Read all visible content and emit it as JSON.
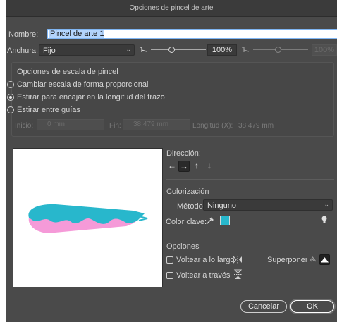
{
  "window": {
    "title": "Opciones de pincel de arte"
  },
  "name": {
    "label": "Nombre:",
    "value": "Pincel de arte 1"
  },
  "width": {
    "label": "Anchura:",
    "mode": "Fijo",
    "percent": "100%",
    "slider_value": 0.5,
    "right_box": "100%"
  },
  "scale": {
    "title": "Opciones de escala de pincel",
    "options": [
      {
        "label": "Cambiar escala de forma proporcional",
        "selected": false
      },
      {
        "label": "Estirar para encajar en la longitud del trazo",
        "selected": true
      },
      {
        "label": "Estirar entre guías",
        "selected": false
      }
    ],
    "start_label": "Inicio:",
    "start_value": "0 mm",
    "end_label": "Fin:",
    "end_value": "38,479 mm",
    "length_label": "Longitud (X):",
    "length_value": "38,479 mm"
  },
  "direction": {
    "title": "Dirección:",
    "buttons": [
      "←",
      "→",
      "↑",
      "↓"
    ],
    "active_index": 1
  },
  "colorization": {
    "title": "Colorización",
    "method_label": "Método:",
    "method_value": "Ninguno",
    "key_label": "Color clave:",
    "key_color": "#28b7cc"
  },
  "options": {
    "title": "Opciones",
    "flip_along": "Voltear a lo largo",
    "flip_across": "Voltear a través",
    "overlap_label": "Superponer:"
  },
  "buttons": {
    "cancel": "Cancelar",
    "ok": "OK"
  },
  "colors": {
    "dialog_bg": "#4a4a4a",
    "brush_teal": "#28b7cc",
    "brush_pink": "#f59ad8",
    "focus_blue": "#7fb5f2"
  }
}
